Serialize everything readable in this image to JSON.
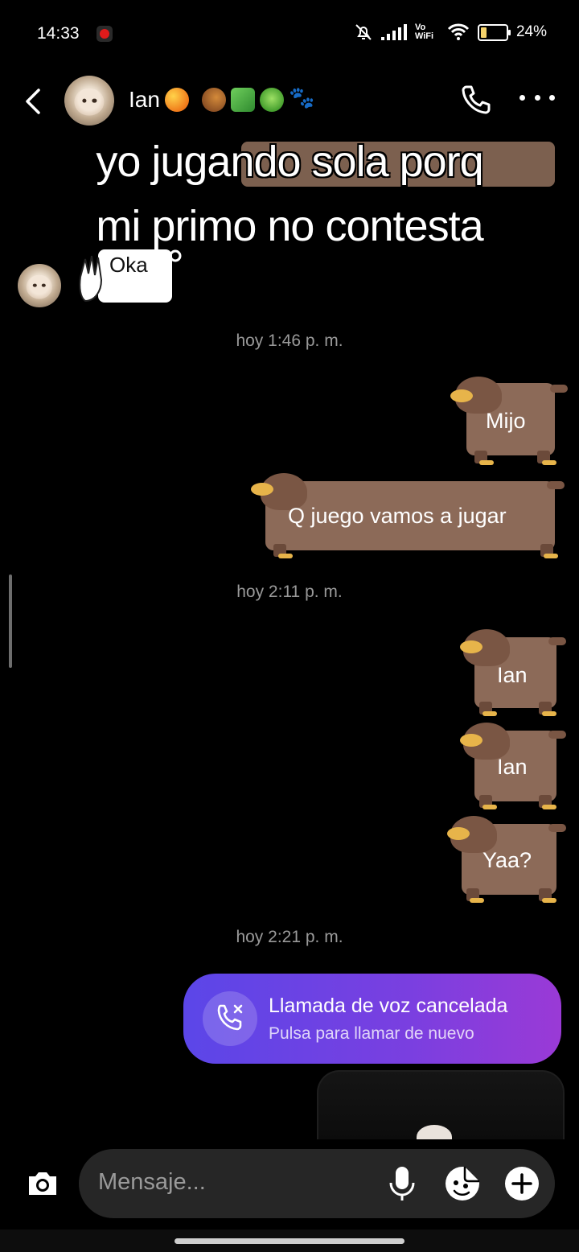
{
  "status_bar": {
    "time": "14:33",
    "network_label": "Vo WiFi",
    "battery": "24%",
    "icons": [
      "screen-record-icon",
      "mute-bell-icon",
      "signal-icon",
      "wifi-icon",
      "battery-icon"
    ]
  },
  "header": {
    "contact_name": "Ian",
    "contact_emojis": [
      "mango-emoji",
      "snail-emoji",
      "money-emoji",
      "frog-emoji",
      "paw-prints-emoji"
    ],
    "icons": [
      "back-icon",
      "phone-icon",
      "more-icon"
    ]
  },
  "caption": {
    "line1": "yo jugando sola porq",
    "line2": "mi primo no contesta"
  },
  "incoming": {
    "sticker_text": "Oka"
  },
  "timestamps": [
    "hoy 1:46 p. m.",
    "hoy 2:11 p. m.",
    "hoy 2:21 p. m."
  ],
  "outgoing": [
    {
      "text": "Mijo"
    },
    {
      "text": "Q juego vamos a jugar"
    },
    {
      "text": "Ian"
    },
    {
      "text": "Ian"
    },
    {
      "text": "Yaa?"
    }
  ],
  "call": {
    "title": "Llamada de voz cancelada",
    "subtitle": "Pulsa para llamar de nuevo"
  },
  "composer": {
    "placeholder": "Mensaje...",
    "icons": [
      "camera-icon",
      "mic-icon",
      "sticker-icon",
      "plus-icon"
    ]
  },
  "colors": {
    "bubble_dog": "#8c6a58",
    "call_gradient_start": "#5b46e8",
    "call_gradient_end": "#9a3ad6",
    "input_bg": "#262626"
  }
}
